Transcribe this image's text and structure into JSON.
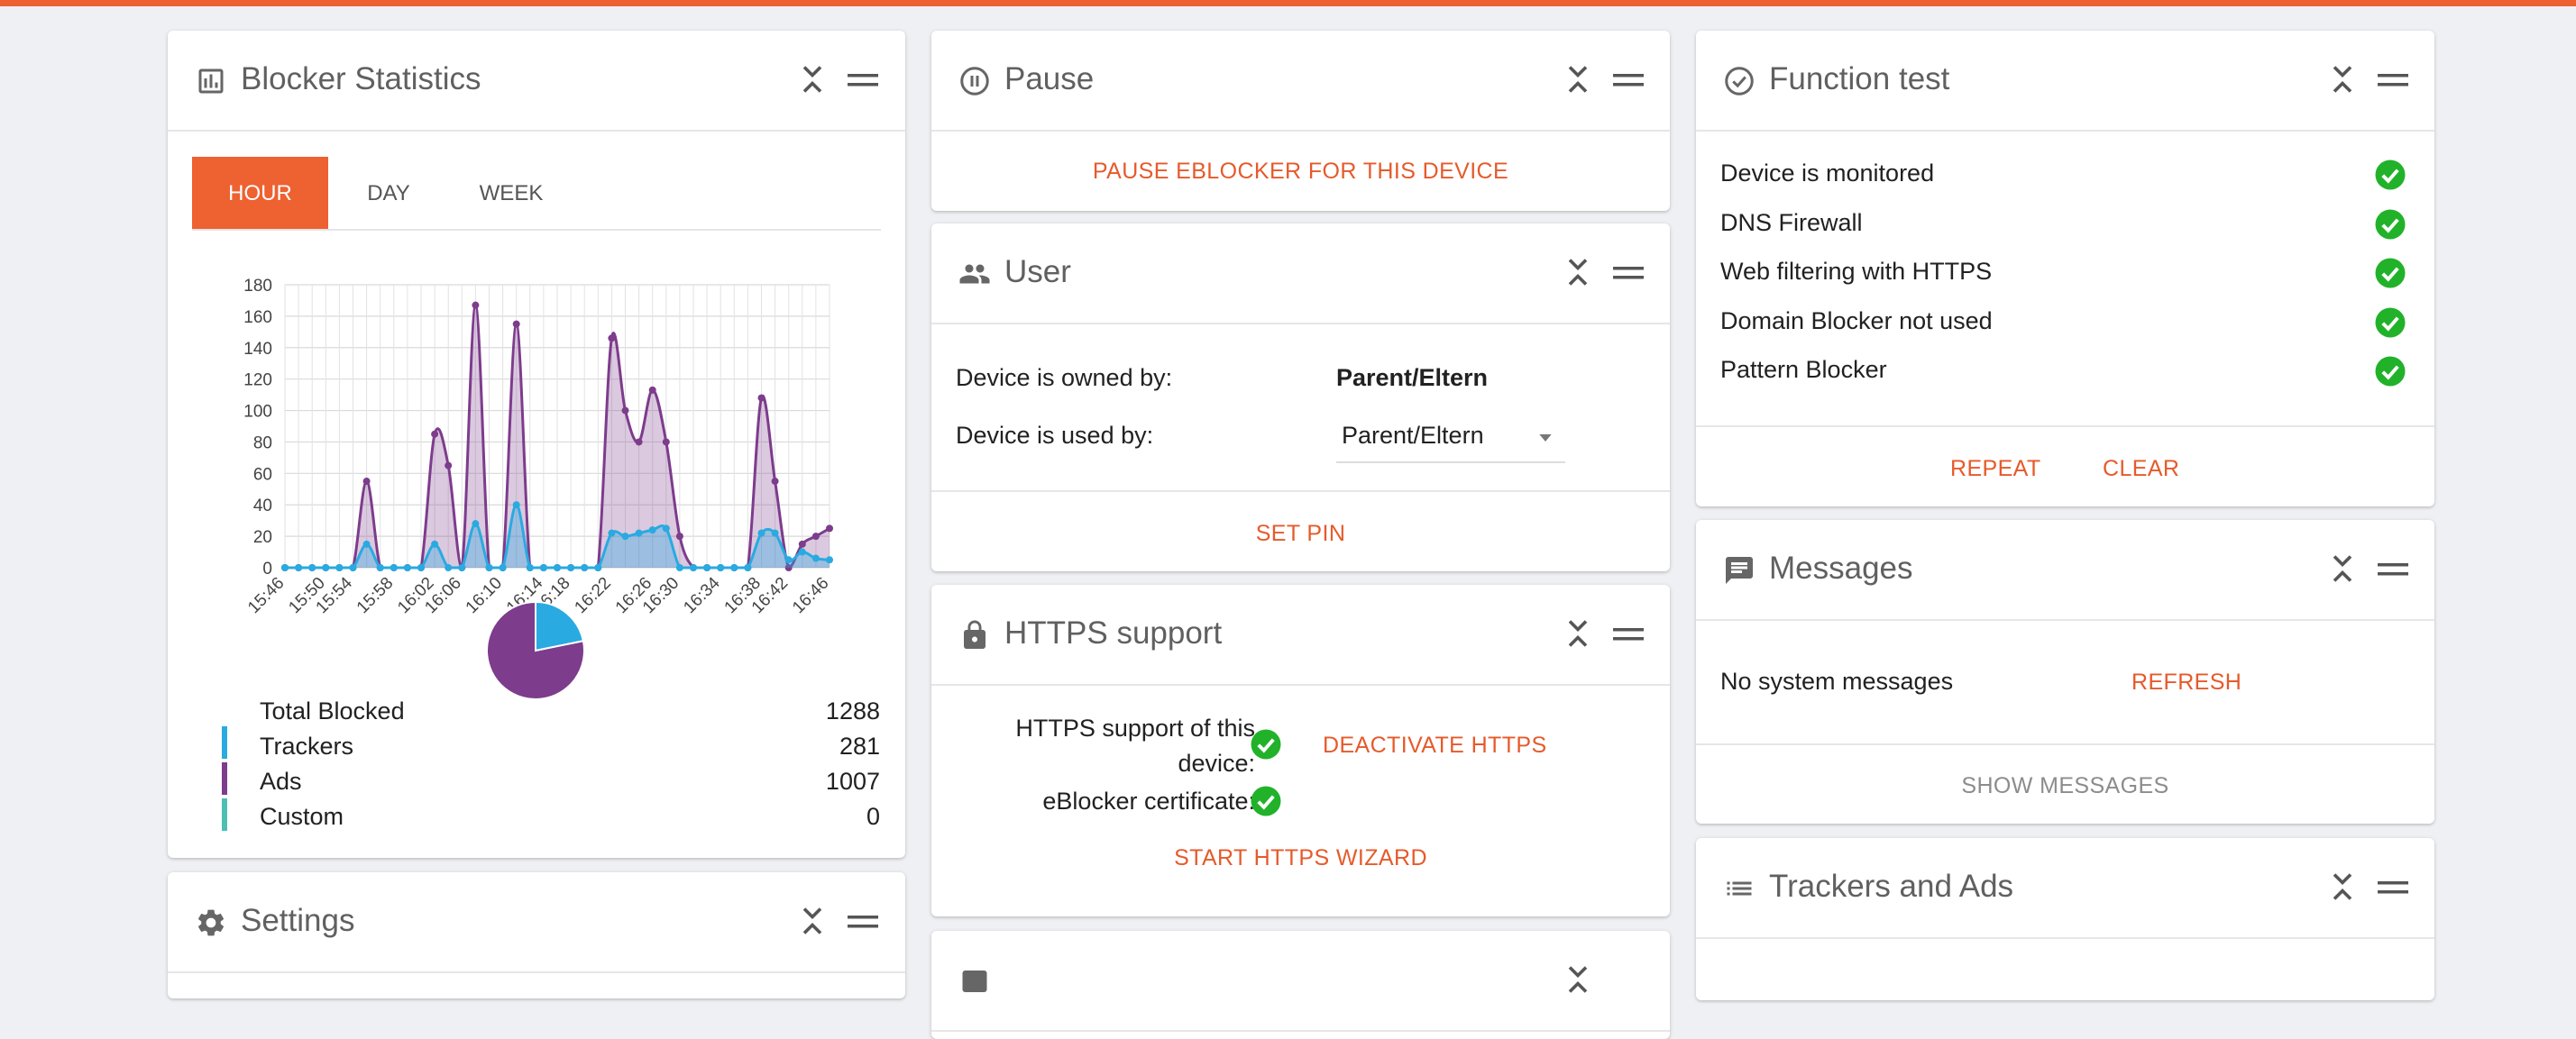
{
  "colors": {
    "accent": "#ee6130",
    "trackers": "#29aae1",
    "ads": "#7d3c8c",
    "custom": "#4dbfb3",
    "check": "#21b22a"
  },
  "blocker": {
    "title": "Blocker Statistics",
    "tabs": [
      {
        "label": "HOUR",
        "active": true
      },
      {
        "label": "DAY",
        "active": false
      },
      {
        "label": "WEEK",
        "active": false
      }
    ],
    "legend": {
      "total": {
        "label": "Total Blocked",
        "value": "1288"
      },
      "items": [
        {
          "label": "Trackers",
          "value": "281"
        },
        {
          "label": "Ads",
          "value": "1007"
        },
        {
          "label": "Custom",
          "value": "0"
        }
      ]
    }
  },
  "chart_data": [
    {
      "type": "area",
      "ylim": [
        0,
        180
      ],
      "yticks": [
        "0",
        "20",
        "40",
        "60",
        "80",
        "100",
        "120",
        "140",
        "160",
        "180"
      ],
      "xticks": [
        "15:46",
        "15:50",
        "15:54",
        "15:58",
        "16:02",
        "16:06",
        "16:10",
        "16:14",
        "16:18",
        "16:22",
        "16:26",
        "16:30",
        "16:34",
        "16:38",
        "16:42",
        "16:46"
      ],
      "x_start": "15:46",
      "x_step_minutes": 1,
      "series": [
        {
          "color": "#7d3c8c",
          "values": [
            0,
            0,
            0,
            0,
            0,
            0,
            55,
            0,
            0,
            0,
            0,
            85,
            65,
            0,
            167,
            0,
            0,
            155,
            0,
            0,
            0,
            0,
            0,
            0,
            146,
            100,
            80,
            113,
            80,
            20,
            0,
            0,
            0,
            0,
            0,
            108,
            55,
            0,
            15,
            20,
            25
          ]
        },
        {
          "color": "#29aae1",
          "values": [
            0,
            0,
            0,
            0,
            0,
            0,
            15,
            0,
            0,
            0,
            0,
            15,
            0,
            0,
            28,
            0,
            0,
            40,
            0,
            0,
            0,
            0,
            0,
            0,
            22,
            20,
            22,
            24,
            25,
            0,
            0,
            0,
            0,
            0,
            0,
            22,
            22,
            5,
            10,
            6,
            5
          ]
        }
      ]
    },
    {
      "type": "pie",
      "series": [
        {
          "values": [
            281,
            1007
          ]
        }
      ]
    }
  ],
  "settings": {
    "title": "Settings"
  },
  "pause": {
    "title": "Pause",
    "action": "PAUSE EBLOCKER FOR THIS DEVICE"
  },
  "user": {
    "title": "User",
    "owned_label": "Device is owned by:",
    "owned_value": "Parent/Eltern",
    "used_label": "Device is used by:",
    "used_value": "Parent/Eltern",
    "set_pin": "SET PIN"
  },
  "https": {
    "title": "HTTPS support",
    "support_line1": "HTTPS support of this",
    "support_line2": "device:",
    "cert_label": "eBlocker certificate:",
    "deactivate": "DEACTIVATE HTTPS",
    "wizard": "START HTTPS WIZARD"
  },
  "function_test": {
    "title": "Function test",
    "items": [
      "Device is monitored",
      "DNS Firewall",
      "Web filtering with HTTPS",
      "Domain Blocker not used",
      "Pattern Blocker"
    ],
    "repeat": "REPEAT",
    "clear": "CLEAR"
  },
  "messages": {
    "title": "Messages",
    "empty": "No system messages",
    "refresh": "REFRESH",
    "show": "SHOW MESSAGES"
  },
  "trackers": {
    "title": "Trackers and Ads"
  }
}
